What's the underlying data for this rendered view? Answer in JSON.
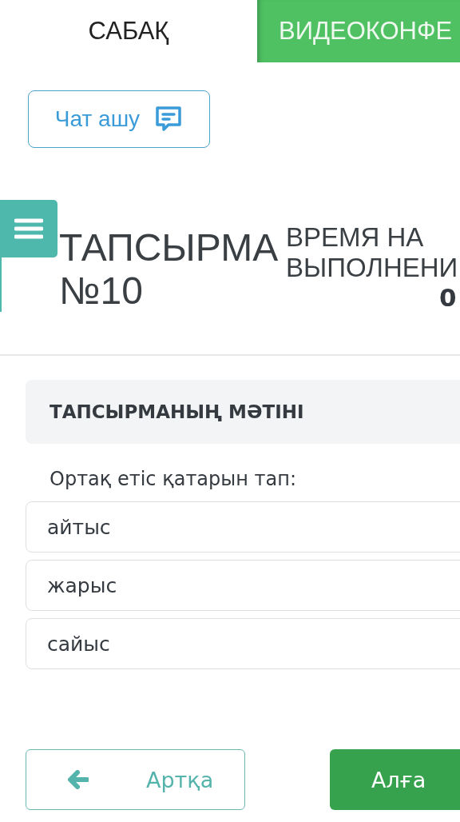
{
  "tabs": [
    {
      "label": "САБАҚ",
      "selected": true
    },
    {
      "label": "ВИДЕОКОНФЕ",
      "selected": false
    }
  ],
  "chat_button": {
    "label": "Чат ашу"
  },
  "task": {
    "title": "ТАПСЫРМА №10",
    "timer_label": "ВРЕМЯ НА ВЫПОЛНЕНИ",
    "timer_value": "0"
  },
  "section": {
    "heading": "ТАПСЫРМАНЫҢ МӘТІНІ",
    "question": "Ортақ етіс қатарын тап:"
  },
  "options": [
    {
      "text": "айтыс"
    },
    {
      "text": "жарыс"
    },
    {
      "text": "сайыс"
    }
  ],
  "nav": {
    "back": "Артқа",
    "forward": "Алға"
  }
}
